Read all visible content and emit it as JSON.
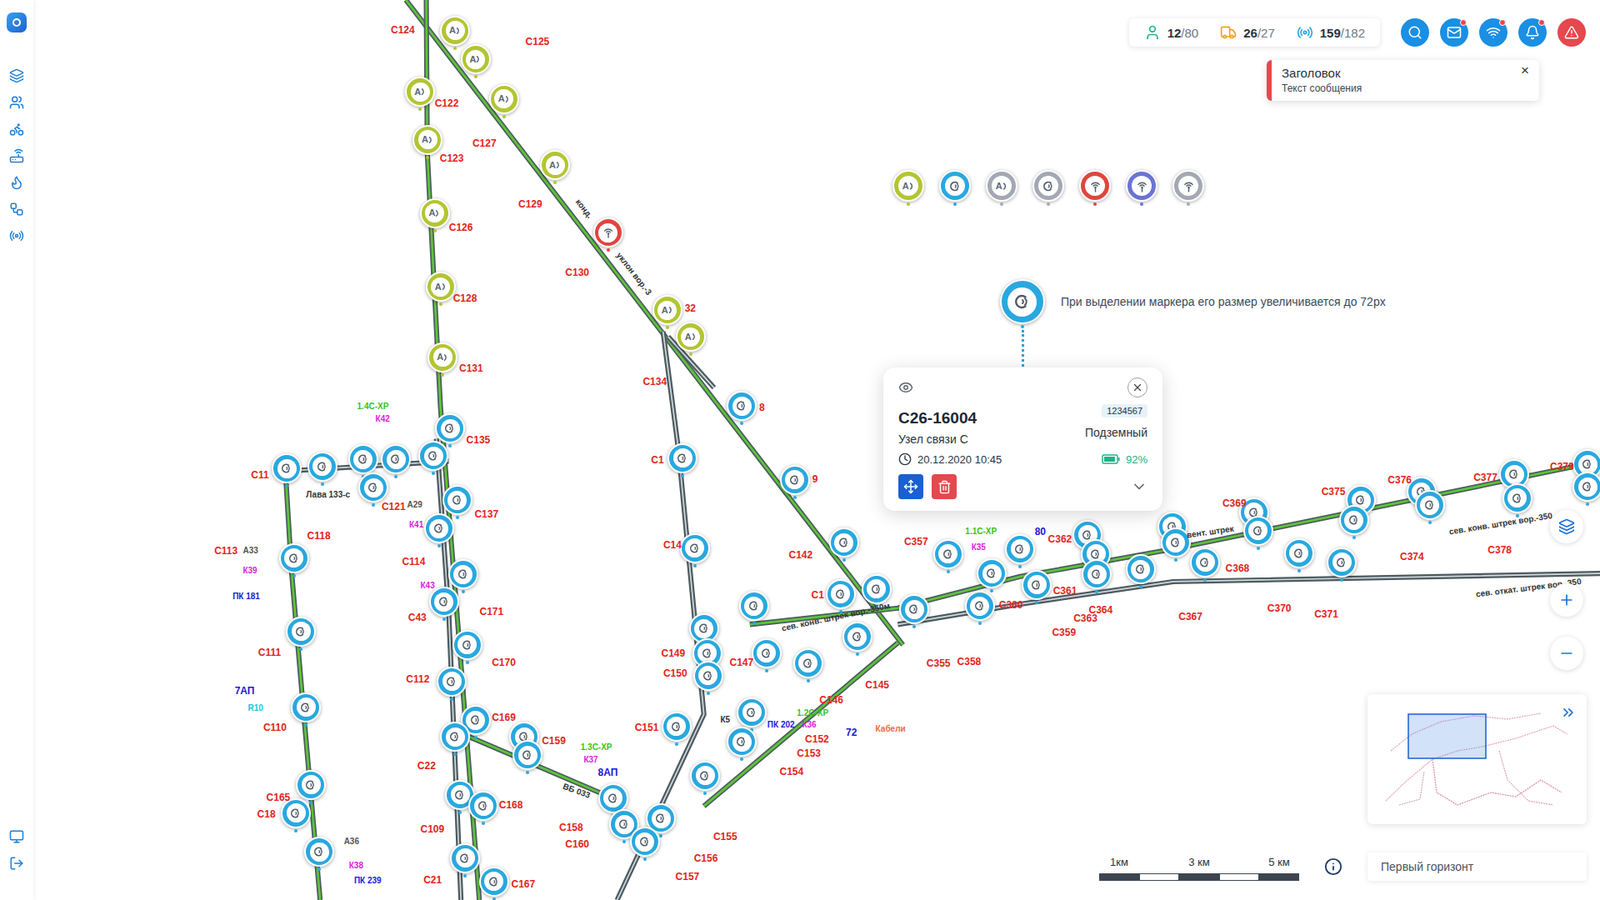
{
  "sidebar": {
    "items": [
      {
        "kind": "layers"
      },
      {
        "kind": "users"
      },
      {
        "kind": "bike"
      },
      {
        "kind": "router"
      },
      {
        "kind": "flame"
      },
      {
        "kind": "workflow"
      },
      {
        "kind": "radio"
      }
    ],
    "bottom": [
      {
        "kind": "monitor"
      },
      {
        "kind": "logout"
      }
    ]
  },
  "stats": [
    {
      "value": "12",
      "total": "/80",
      "color": "#1fb28a"
    },
    {
      "value": "26",
      "total": "/27",
      "color": "#f0a31d"
    },
    {
      "value": "159",
      "total": "/182",
      "color": "#29a8df"
    }
  ],
  "actions": [
    {
      "kind": "search",
      "badge": false,
      "color": "#1a8fe3"
    },
    {
      "kind": "mail",
      "badge": true,
      "color": "#1a8fe3"
    },
    {
      "kind": "wifi",
      "badge": true,
      "color": "#1a8fe3"
    },
    {
      "kind": "bell",
      "badge": true,
      "color": "#1a8fe3"
    },
    {
      "kind": "alert",
      "badge": false,
      "color": "#e5484d"
    }
  ],
  "toast": {
    "title": "Заголовок",
    "text": "Текст сообщения",
    "close": "×"
  },
  "legend": [
    {
      "kind": "a",
      "letter": "A",
      "color": "#b3c531"
    },
    {
      "kind": "c",
      "letter": "",
      "color": "#29a8df"
    },
    {
      "kind": "a",
      "letter": "A",
      "color": "#a3a8b4"
    },
    {
      "kind": "c",
      "letter": "",
      "color": "#a3a8b4"
    },
    {
      "kind": "signal",
      "letter": "",
      "color": "#e0453f"
    },
    {
      "kind": "signal",
      "letter": "",
      "color": "#6b73d6"
    },
    {
      "kind": "signal",
      "letter": "",
      "color": "#a3a8b4"
    }
  ],
  "hint": {
    "text": "При выделении маркера его размер увеличивается до 72px",
    "kind": "c",
    "letter": "",
    "color": "#29a8df",
    "selected": true
  },
  "popup": {
    "title": "С26-16004",
    "subtitle": "Узел связи С",
    "id": "1234567",
    "type": "Подземный",
    "time": "20.12.2020 10:45",
    "battery": "92%",
    "level": 0.92
  },
  "markers": [
    {
      "kind": "a",
      "letter": "A",
      "color": "#b3c531",
      "selected": false
    },
    {
      "kind": "a",
      "letter": "A",
      "color": "#b3c531",
      "selected": false
    },
    {
      "kind": "a",
      "letter": "A",
      "color": "#b3c531",
      "selected": false
    },
    {
      "kind": "a",
      "letter": "A",
      "color": "#b3c531",
      "selected": false
    },
    {
      "kind": "a",
      "letter": "A",
      "color": "#b3c531",
      "selected": false
    },
    {
      "kind": "a",
      "letter": "A",
      "color": "#b3c531",
      "selected": false
    },
    {
      "kind": "a",
      "letter": "A",
      "color": "#b3c531",
      "selected": false
    },
    {
      "kind": "a",
      "letter": "A",
      "color": "#b3c531",
      "selected": false
    },
    {
      "kind": "a",
      "letter": "A",
      "color": "#b3c531",
      "selected": false
    },
    {
      "kind": "a",
      "letter": "A",
      "color": "#b3c531",
      "selected": false
    },
    {
      "kind": "a",
      "letter": "A",
      "color": "#b3c531",
      "selected": false
    },
    {
      "kind": "signal",
      "letter": "",
      "color": "#e0453f",
      "selected": false
    },
    {
      "kind": "c",
      "letter": "",
      "color": "#29a8df",
      "selected": false
    },
    {
      "kind": "c",
      "letter": "",
      "color": "#29a8df",
      "selected": false
    },
    {
      "kind": "c",
      "letter": "",
      "color": "#29a8df",
      "selected": false
    },
    {
      "kind": "c",
      "letter": "",
      "color": "#29a8df",
      "selected": false
    },
    {
      "kind": "c",
      "letter": "",
      "color": "#29a8df",
      "selected": false
    },
    {
      "kind": "c",
      "letter": "",
      "color": "#29a8df",
      "selected": false
    },
    {
      "kind": "c",
      "letter": "",
      "color": "#29a8df",
      "selected": false
    },
    {
      "kind": "c",
      "letter": "",
      "color": "#29a8df",
      "selected": false
    },
    {
      "kind": "c",
      "letter": "",
      "color": "#29a8df",
      "selected": false
    },
    {
      "kind": "c",
      "letter": "",
      "color": "#29a8df",
      "selected": false
    },
    {
      "kind": "c",
      "letter": "",
      "color": "#29a8df",
      "selected": false
    },
    {
      "kind": "c",
      "letter": "",
      "color": "#29a8df",
      "selected": false
    },
    {
      "kind": "c",
      "letter": "",
      "color": "#29a8df",
      "selected": false
    },
    {
      "kind": "c",
      "letter": "",
      "color": "#29a8df",
      "selected": false
    },
    {
      "kind": "c",
      "letter": "",
      "color": "#29a8df",
      "selected": false
    },
    {
      "kind": "c",
      "letter": "",
      "color": "#29a8df",
      "selected": false
    },
    {
      "kind": "c",
      "letter": "",
      "color": "#29a8df",
      "selected": false
    },
    {
      "kind": "c",
      "letter": "",
      "color": "#29a8df",
      "selected": false
    },
    {
      "kind": "c",
      "letter": "",
      "color": "#29a8df",
      "selected": false
    },
    {
      "kind": "c",
      "letter": "",
      "color": "#29a8df",
      "selected": false
    },
    {
      "kind": "c",
      "letter": "",
      "color": "#29a8df",
      "selected": false
    },
    {
      "kind": "c",
      "letter": "",
      "color": "#29a8df",
      "selected": false
    },
    {
      "kind": "c",
      "letter": "",
      "color": "#29a8df",
      "selected": false
    },
    {
      "kind": "c",
      "letter": "",
      "color": "#29a8df",
      "selected": false
    },
    {
      "kind": "c",
      "letter": "",
      "color": "#29a8df",
      "selected": false
    },
    {
      "kind": "c",
      "letter": "",
      "color": "#29a8df",
      "selected": false
    },
    {
      "kind": "c",
      "letter": "",
      "color": "#29a8df",
      "selected": false
    },
    {
      "kind": "c",
      "letter": "",
      "color": "#29a8df",
      "selected": false
    },
    {
      "kind": "c",
      "letter": "",
      "color": "#29a8df",
      "selected": false
    },
    {
      "kind": "c",
      "letter": "",
      "color": "#29a8df",
      "selected": false
    },
    {
      "kind": "c",
      "letter": "",
      "color": "#29a8df",
      "selected": false
    },
    {
      "kind": "c",
      "letter": "",
      "color": "#29a8df",
      "selected": false
    },
    {
      "kind": "c",
      "letter": "",
      "color": "#29a8df",
      "selected": false
    },
    {
      "kind": "c",
      "letter": "",
      "color": "#29a8df",
      "selected": false
    },
    {
      "kind": "c",
      "letter": "",
      "color": "#29a8df",
      "selected": false
    },
    {
      "kind": "c",
      "letter": "",
      "color": "#29a8df",
      "selected": false
    },
    {
      "kind": "c",
      "letter": "",
      "color": "#29a8df",
      "selected": false
    },
    {
      "kind": "c",
      "letter": "",
      "color": "#29a8df",
      "selected": false
    },
    {
      "kind": "c",
      "letter": "",
      "color": "#29a8df",
      "selected": false
    },
    {
      "kind": "c",
      "letter": "",
      "color": "#29a8df",
      "selected": false
    },
    {
      "kind": "c",
      "letter": "",
      "color": "#29a8df",
      "selected": false
    },
    {
      "kind": "c",
      "letter": "",
      "color": "#29a8df",
      "selected": false
    },
    {
      "kind": "c",
      "letter": "",
      "color": "#29a8df",
      "selected": false
    },
    {
      "kind": "c",
      "letter": "",
      "color": "#29a8df",
      "selected": false
    },
    {
      "kind": "c",
      "letter": "",
      "color": "#29a8df",
      "selected": false
    },
    {
      "kind": "c",
      "letter": "",
      "color": "#29a8df",
      "selected": false
    },
    {
      "kind": "c",
      "letter": "",
      "color": "#29a8df",
      "selected": false
    },
    {
      "kind": "c",
      "letter": "",
      "color": "#29a8df",
      "selected": false
    },
    {
      "kind": "c",
      "letter": "",
      "color": "#29a8df",
      "selected": false
    },
    {
      "kind": "c",
      "letter": "",
      "color": "#29a8df",
      "selected": false
    },
    {
      "kind": "c",
      "letter": "",
      "color": "#29a8df",
      "selected": false
    },
    {
      "kind": "c",
      "letter": "",
      "color": "#29a8df",
      "selected": false
    },
    {
      "kind": "c",
      "letter": "",
      "color": "#29a8df",
      "selected": false
    },
    {
      "kind": "c",
      "letter": "",
      "color": "#29a8df",
      "selected": false
    },
    {
      "kind": "c",
      "letter": "",
      "color": "#29a8df",
      "selected": false
    },
    {
      "kind": "c",
      "letter": "",
      "color": "#29a8df",
      "selected": false
    },
    {
      "kind": "c",
      "letter": "",
      "color": "#29a8df",
      "selected": false
    },
    {
      "kind": "c",
      "letter": "",
      "color": "#29a8df",
      "selected": false
    },
    {
      "kind": "c",
      "letter": "",
      "color": "#29a8df",
      "selected": false
    },
    {
      "kind": "c",
      "letter": "",
      "color": "#29a8df",
      "selected": false
    },
    {
      "kind": "c",
      "letter": "",
      "color": "#29a8df",
      "selected": false
    },
    {
      "kind": "c",
      "letter": "",
      "color": "#29a8df",
      "selected": false
    },
    {
      "kind": "c",
      "letter": "",
      "color": "#29a8df",
      "selected": false
    },
    {
      "kind": "c",
      "letter": "",
      "color": "#29a8df",
      "selected": false
    },
    {
      "kind": "c",
      "letter": "",
      "color": "#29a8df",
      "selected": false
    },
    {
      "kind": "c",
      "letter": "",
      "color": "#29a8df",
      "selected": false
    },
    {
      "kind": "c",
      "letter": "",
      "color": "#29a8df",
      "selected": false
    },
    {
      "kind": "c",
      "letter": "",
      "color": "#29a8df",
      "selected": false
    },
    {
      "kind": "c",
      "letter": "",
      "color": "#29a8df",
      "selected": false
    },
    {
      "kind": "c",
      "letter": "",
      "color": "#29a8df",
      "selected": false
    },
    {
      "kind": "c",
      "letter": "",
      "color": "#29a8df",
      "selected": false
    },
    {
      "kind": "c",
      "letter": "",
      "color": "#29a8df",
      "selected": false
    },
    {
      "kind": "c",
      "letter": "",
      "color": "#29a8df",
      "selected": false
    },
    {
      "kind": "c",
      "letter": "",
      "color": "#29a8df",
      "selected": false
    }
  ],
  "labels": [
    {
      "text": "С124",
      "color": "#e3241b"
    },
    {
      "text": "С125",
      "color": "#e3241b"
    },
    {
      "text": "С122",
      "color": "#e3241b"
    },
    {
      "text": "С127",
      "color": "#e3241b"
    },
    {
      "text": "С123",
      "color": "#e3241b"
    },
    {
      "text": "С129",
      "color": "#e3241b"
    },
    {
      "text": "С126",
      "color": "#e3241b"
    },
    {
      "text": "С130",
      "color": "#e3241b"
    },
    {
      "text": "С128",
      "color": "#e3241b"
    },
    {
      "text": "С131",
      "color": "#e3241b"
    },
    {
      "text": "32",
      "color": "#e3241b"
    },
    {
      "text": "С134",
      "color": "#e3241b"
    },
    {
      "text": "8",
      "color": "#e3241b"
    },
    {
      "text": "С135",
      "color": "#e3241b"
    },
    {
      "text": "С1",
      "color": "#e3241b"
    },
    {
      "text": "9",
      "color": "#e3241b"
    },
    {
      "text": "С11",
      "color": "#e3241b"
    },
    {
      "text": "С121",
      "color": "#e3241b"
    },
    {
      "text": "С137",
      "color": "#e3241b"
    },
    {
      "text": "С118",
      "color": "#e3241b"
    },
    {
      "text": "С113",
      "color": "#e3241b"
    },
    {
      "text": "С114",
      "color": "#e3241b"
    },
    {
      "text": "С43",
      "color": "#e3241b"
    },
    {
      "text": "С171",
      "color": "#e3241b"
    },
    {
      "text": "С111",
      "color": "#e3241b"
    },
    {
      "text": "С170",
      "color": "#e3241b"
    },
    {
      "text": "С112",
      "color": "#e3241b"
    },
    {
      "text": "С110",
      "color": "#e3241b"
    },
    {
      "text": "С169",
      "color": "#e3241b"
    },
    {
      "text": "С22",
      "color": "#e3241b"
    },
    {
      "text": "С159",
      "color": "#e3241b"
    },
    {
      "text": "С165",
      "color": "#e3241b"
    },
    {
      "text": "С18",
      "color": "#e3241b"
    },
    {
      "text": "С168",
      "color": "#e3241b"
    },
    {
      "text": "С109",
      "color": "#e3241b"
    },
    {
      "text": "С21",
      "color": "#e3241b"
    },
    {
      "text": "С167",
      "color": "#e3241b"
    },
    {
      "text": "С158",
      "color": "#e3241b"
    },
    {
      "text": "С160",
      "color": "#e3241b"
    },
    {
      "text": "С156",
      "color": "#e3241b"
    },
    {
      "text": "С157",
      "color": "#e3241b"
    },
    {
      "text": "С155",
      "color": "#e3241b"
    },
    {
      "text": "С154",
      "color": "#e3241b"
    },
    {
      "text": "С153",
      "color": "#e3241b"
    },
    {
      "text": "С152",
      "color": "#e3241b"
    },
    {
      "text": "С146",
      "color": "#e3241b"
    },
    {
      "text": "С145",
      "color": "#e3241b"
    },
    {
      "text": "С147",
      "color": "#e3241b"
    },
    {
      "text": "С149",
      "color": "#e3241b"
    },
    {
      "text": "С150",
      "color": "#e3241b"
    },
    {
      "text": "С151",
      "color": "#e3241b"
    },
    {
      "text": "С142",
      "color": "#e3241b"
    },
    {
      "text": "С14",
      "color": "#e3241b"
    },
    {
      "text": "С1",
      "color": "#e3241b"
    },
    {
      "text": "С355",
      "color": "#e3241b"
    },
    {
      "text": "С358",
      "color": "#e3241b"
    },
    {
      "text": "С359",
      "color": "#e3241b"
    },
    {
      "text": "С357",
      "color": "#e3241b"
    },
    {
      "text": "С362",
      "color": "#e3241b"
    },
    {
      "text": "С361",
      "color": "#e3241b"
    },
    {
      "text": "С363",
      "color": "#e3241b"
    },
    {
      "text": "С360",
      "color": "#e3241b"
    },
    {
      "text": "С364",
      "color": "#e3241b"
    },
    {
      "text": "С367",
      "color": "#e3241b"
    },
    {
      "text": "С368",
      "color": "#e3241b"
    },
    {
      "text": "С370",
      "color": "#e3241b"
    },
    {
      "text": "С371",
      "color": "#e3241b"
    },
    {
      "text": "С374",
      "color": "#e3241b"
    },
    {
      "text": "С375",
      "color": "#e3241b"
    },
    {
      "text": "С376",
      "color": "#e3241b"
    },
    {
      "text": "С377",
      "color": "#e3241b"
    },
    {
      "text": "С378",
      "color": "#e3241b"
    },
    {
      "text": "С379",
      "color": "#e3241b"
    },
    {
      "text": "С369",
      "color": "#e3241b"
    },
    {
      "text": "1.4С-ХР",
      "color": "#39c21a"
    },
    {
      "text": "К42",
      "color": "#d81fd8"
    },
    {
      "text": "К41",
      "color": "#d81fd8"
    },
    {
      "text": "К43",
      "color": "#d81fd8"
    },
    {
      "text": "К39",
      "color": "#d81fd8"
    },
    {
      "text": "А33",
      "color": "#555555"
    },
    {
      "text": "А29",
      "color": "#555555"
    },
    {
      "text": "ПК 181",
      "color": "#1a1ad4"
    },
    {
      "text": "7АП",
      "color": "#1a1ad4"
    },
    {
      "text": "R10",
      "color": "#16c9d9"
    },
    {
      "text": "А36",
      "color": "#555555"
    },
    {
      "text": "К38",
      "color": "#d81fd8"
    },
    {
      "text": "ПК 239",
      "color": "#1a1ad4"
    },
    {
      "text": "1.1С-ХР",
      "color": "#39c21a"
    },
    {
      "text": "К35",
      "color": "#d81fd8"
    },
    {
      "text": "80",
      "color": "#1a1ad4"
    },
    {
      "text": "1.2С-ХР",
      "color": "#39c21a"
    },
    {
      "text": "К36",
      "color": "#d81fd8"
    },
    {
      "text": "ПК 202",
      "color": "#1a1ad4"
    },
    {
      "text": "72",
      "color": "#1a1ad4"
    },
    {
      "text": "1.3С-ХР",
      "color": "#39c21a"
    },
    {
      "text": "К37",
      "color": "#d81fd8"
    },
    {
      "text": "8АП",
      "color": "#1a1ad4"
    },
    {
      "text": "К5",
      "color": "#333333"
    },
    {
      "text": "Кабели",
      "color": "#f06a3a"
    },
    {
      "text": "вент. штрек",
      "color": "#333333"
    },
    {
      "text": "сев. конв. штрек  вор.-350",
      "color": "#333333"
    },
    {
      "text": "сев. откат. штрек  вор.-350",
      "color": "#333333"
    },
    {
      "text": "сев. конв. штрек вор.-350м",
      "color": "#333333"
    },
    {
      "text": "Лава 133-с",
      "color": "#333333"
    },
    {
      "text": "ВБ 033",
      "color": "#333333"
    },
    {
      "text": "уклон вор.-3",
      "color": "#333333"
    },
    {
      "text": "конд.",
      "color": "#333333"
    }
  ],
  "scale": [
    "1км",
    "3 км",
    "5 км"
  ],
  "floor": {
    "value": "Первый горизонт"
  }
}
